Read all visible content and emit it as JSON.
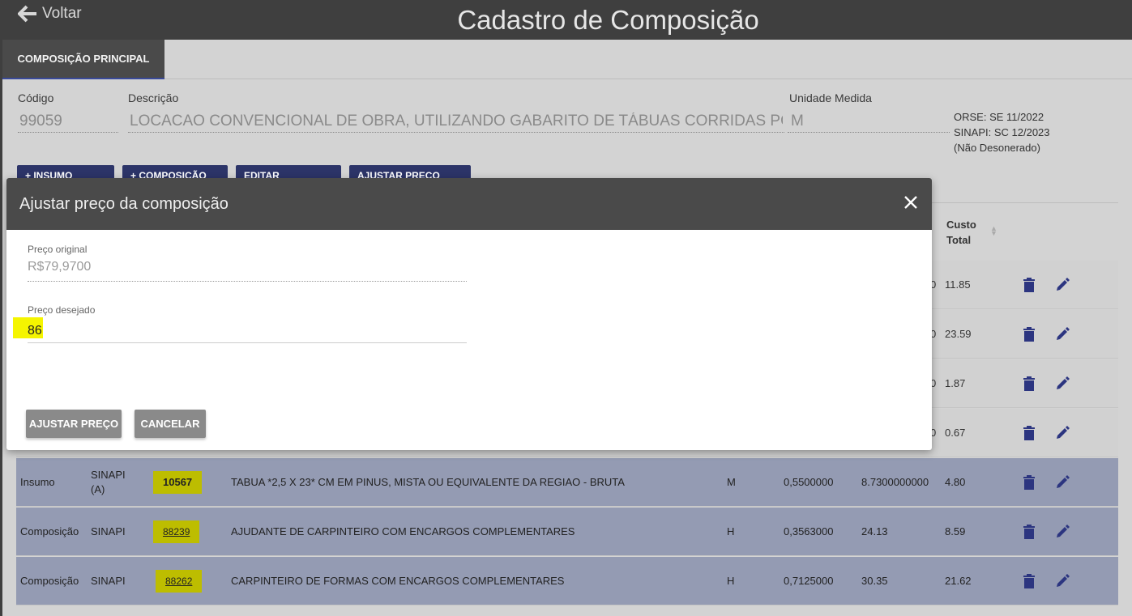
{
  "header": {
    "back_label": "Voltar",
    "title": "Cadastro de Composição"
  },
  "tabs": [
    {
      "label": "COMPOSIÇÃO PRINCIPAL",
      "active": true
    }
  ],
  "form": {
    "codigo_label": "Código",
    "codigo_value": "99059",
    "descricao_label": "Descrição",
    "descricao_value": "LOCACAO CONVENCIONAL DE OBRA, UTILIZANDO GABARITO DE TÁBUAS CORRIDAS PON",
    "unidade_label": "Unidade Medida",
    "unidade_value": "M",
    "refs": [
      "ORSE: SE 11/2022",
      "SINAPI: SC 12/2023",
      "(Não Desonerado)"
    ]
  },
  "actions": [
    "+ INSUMO",
    "+ COMPOSIÇÃO",
    "EDITAR",
    "AJUSTAR PREÇO"
  ],
  "table": {
    "header_custo_total": [
      "Custo",
      "Total"
    ],
    "partial_rows": [
      {
        "custo_total": "11.85"
      },
      {
        "custo_total": "23.59"
      },
      {
        "custo_total": "1.87"
      },
      {
        "custo_total": "0.67"
      }
    ],
    "rows": [
      {
        "tipo": "Insumo",
        "fonte": "SINAPI (A)",
        "codigo": "10567",
        "descricao": "TABUA *2,5 X 23* CM EM PINUS, MISTA OU EQUIVALENTE DA REGIAO - BRUTA",
        "unidade": "M",
        "coeficiente": "0,5500000",
        "preco": "8.7300000000",
        "custo_total": "4.80"
      },
      {
        "tipo": "Composição",
        "fonte": "SINAPI",
        "codigo": "88239",
        "descricao": "AJUDANTE DE CARPINTEIRO COM ENCARGOS COMPLEMENTARES",
        "unidade": "H",
        "coeficiente": "0,3563000",
        "preco": "24.13",
        "custo_total": "8.59"
      },
      {
        "tipo": "Composição",
        "fonte": "SINAPI",
        "codigo": "88262",
        "descricao": "CARPINTEIRO DE FORMAS COM ENCARGOS COMPLEMENTARES",
        "unidade": "H",
        "coeficiente": "0,7125000",
        "preco": "30.35",
        "custo_total": "21.62"
      }
    ]
  },
  "modal": {
    "title": "Ajustar preço da composição",
    "original_label": "Preço original",
    "original_value": "R$79,9700",
    "desired_label": "Preço desejado",
    "desired_value": "86",
    "confirm_label": "AJUSTAR PREÇO",
    "cancel_label": "CANCELAR"
  },
  "colors": {
    "header_bg": "#3f3f3f",
    "action_blue": "#2c3468",
    "icon_blue": "#2c3580",
    "highlight": "#bdbd00",
    "input_highlight": "#f5f500"
  }
}
